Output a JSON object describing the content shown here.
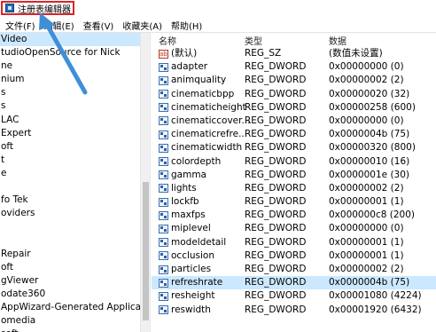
{
  "window": {
    "title": "注册表编辑器",
    "icon": "registry-editor-icon"
  },
  "menu": [
    "文件(F)",
    "编辑(E)",
    "查看(V)",
    "收藏夹(A)",
    "帮助(H)"
  ],
  "tree": {
    "items": [
      {
        "label": "Video",
        "selected": true
      },
      {
        "label": "tudioOpenSource for Nick"
      },
      {
        "label": "ne"
      },
      {
        "label": "nium"
      },
      {
        "label": "s"
      },
      {
        "label": "s"
      },
      {
        "label": "LAC"
      },
      {
        "label": "Expert"
      },
      {
        "label": "oft"
      },
      {
        "label": "t"
      },
      {
        "label": "e"
      },
      {
        "label": ""
      },
      {
        "label": "fo Tek"
      },
      {
        "label": "oviders"
      },
      {
        "label": ""
      },
      {
        "label": ""
      },
      {
        "label": "Repair"
      },
      {
        "label": "oft"
      },
      {
        "label": "gViewer"
      },
      {
        "label": "odate360"
      },
      {
        "label": "AppWizard-Generated Application"
      },
      {
        "label": "omedia"
      },
      {
        "label": "soft"
      }
    ]
  },
  "values": {
    "headers": {
      "name": "名称",
      "type": "类型",
      "data": "数据"
    },
    "rows": [
      {
        "icon": "string-value-icon",
        "name": "(默认)",
        "type": "REG_SZ",
        "data": "(数值未设置)"
      },
      {
        "icon": "binary-value-icon",
        "name": "adapter",
        "type": "REG_DWORD",
        "data": "0x00000000 (0)"
      },
      {
        "icon": "binary-value-icon",
        "name": "animquality",
        "type": "REG_DWORD",
        "data": "0x00000002 (2)"
      },
      {
        "icon": "binary-value-icon",
        "name": "cinematicbpp",
        "type": "REG_DWORD",
        "data": "0x00000020 (32)"
      },
      {
        "icon": "binary-value-icon",
        "name": "cinematicheight",
        "type": "REG_DWORD",
        "data": "0x00000258 (600)"
      },
      {
        "icon": "binary-value-icon",
        "name": "cinematiccover...",
        "type": "REG_DWORD",
        "data": "0x00000000 (0)"
      },
      {
        "icon": "binary-value-icon",
        "name": "cinematicrefre...",
        "type": "REG_DWORD",
        "data": "0x0000004b (75)"
      },
      {
        "icon": "binary-value-icon",
        "name": "cinematicwidth",
        "type": "REG_DWORD",
        "data": "0x00000320 (800)"
      },
      {
        "icon": "binary-value-icon",
        "name": "colordepth",
        "type": "REG_DWORD",
        "data": "0x00000010 (16)"
      },
      {
        "icon": "binary-value-icon",
        "name": "gamma",
        "type": "REG_DWORD",
        "data": "0x0000001e (30)"
      },
      {
        "icon": "binary-value-icon",
        "name": "lights",
        "type": "REG_DWORD",
        "data": "0x00000002 (2)"
      },
      {
        "icon": "binary-value-icon",
        "name": "lockfb",
        "type": "REG_DWORD",
        "data": "0x00000001 (1)"
      },
      {
        "icon": "binary-value-icon",
        "name": "maxfps",
        "type": "REG_DWORD",
        "data": "0x000000c8 (200)"
      },
      {
        "icon": "binary-value-icon",
        "name": "miplevel",
        "type": "REG_DWORD",
        "data": "0x00000000 (0)"
      },
      {
        "icon": "binary-value-icon",
        "name": "modeldetail",
        "type": "REG_DWORD",
        "data": "0x00000001 (1)"
      },
      {
        "icon": "binary-value-icon",
        "name": "occlusion",
        "type": "REG_DWORD",
        "data": "0x00000001 (1)"
      },
      {
        "icon": "binary-value-icon",
        "name": "particles",
        "type": "REG_DWORD",
        "data": "0x00000002 (2)"
      },
      {
        "icon": "binary-value-icon",
        "name": "refreshrate",
        "type": "REG_DWORD",
        "data": "0x0000004b (75)",
        "selected": true
      },
      {
        "icon": "binary-value-icon",
        "name": "resheight",
        "type": "REG_DWORD",
        "data": "0x00001080 (4224)"
      },
      {
        "icon": "binary-value-icon",
        "name": "reswidth",
        "type": "REG_DWORD",
        "data": "0x00001920 (6432)"
      }
    ]
  },
  "colors": {
    "highlight": "#cce8ff",
    "annotation": "#d9262c",
    "arrow": "#3f8fd6"
  }
}
